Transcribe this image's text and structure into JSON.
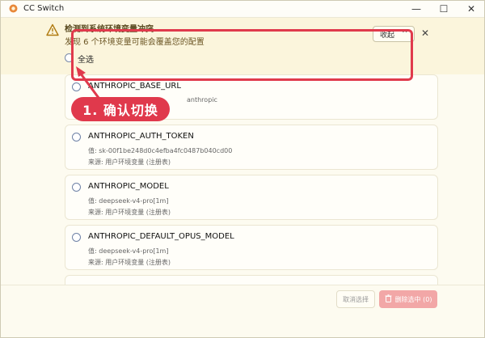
{
  "window": {
    "title": "CC Switch",
    "controls": {
      "minimize": "—",
      "maximize": "☐",
      "close": "✕"
    }
  },
  "banner": {
    "title": "检测到系统环境变量冲突",
    "subtitle": "发现 6 个环境变量可能会覆盖您的配置",
    "select_all": "全选",
    "collapse_label": "收起",
    "close_label": "✕"
  },
  "callout": {
    "text": "1. 确认切换",
    "color": "#e0394c"
  },
  "variables": [
    {
      "name": "ANTHROPIC_BASE_URL",
      "value": "anthropic",
      "source": ""
    },
    {
      "name": "ANTHROPIC_AUTH_TOKEN",
      "value": "值: sk-00f1be248d0c4efba4fc0487b040cd00",
      "source": "来源: 用户环境变量 (注册表)"
    },
    {
      "name": "ANTHROPIC_MODEL",
      "value": "值: deepseek-v4-pro[1m]",
      "source": "来源: 用户环境变量 (注册表)"
    },
    {
      "name": "ANTHROPIC_DEFAULT_OPUS_MODEL",
      "value": "值: deepseek-v4-pro[1m]",
      "source": "来源: 用户环境变量 (注册表)"
    }
  ],
  "footer": {
    "cancel_label": "取消选择",
    "delete_label": "删除选中 (0)"
  },
  "colors": {
    "warning_bg": "#fbf5dc",
    "accent_red": "#e03a4c",
    "delete_btn": "#f2a7a7"
  },
  "icons": {
    "app": "switch-icon",
    "warning": "warning-triangle-icon",
    "trash": "trash-icon"
  }
}
